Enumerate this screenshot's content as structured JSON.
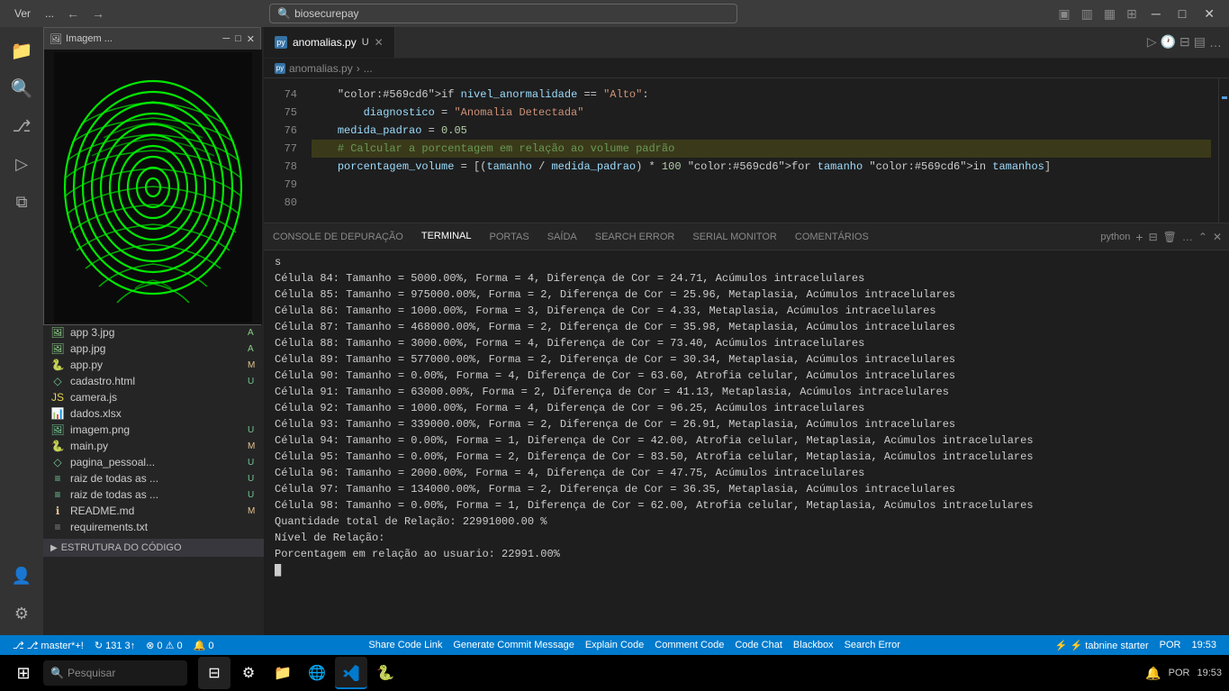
{
  "titleBar": {
    "title": "Imagem ...",
    "controls": [
      "minimize",
      "maximize",
      "close"
    ]
  },
  "menuBar": {
    "items": [
      "Ver"
    ],
    "searchPlaceholder": "biosecurepay",
    "moreBtn": "...",
    "navBack": "←",
    "navForward": "→"
  },
  "tabs": [
    {
      "label": "anomalias.py",
      "modified": true,
      "active": true,
      "icon": "py"
    }
  ],
  "breadcrumb": {
    "parts": [
      "anomalias.py",
      "..."
    ]
  },
  "codeLines": [
    {
      "num": "74",
      "text": "    if nivel_anormalidade == \"Alto\":",
      "highlight": false
    },
    {
      "num": "75",
      "text": "        diagnostico = \"Anomalia Detectada\"",
      "highlight": false
    },
    {
      "num": "76",
      "text": "",
      "highlight": false
    },
    {
      "num": "77",
      "text": "    medida_padrao = 0.05",
      "highlight": false
    },
    {
      "num": "78",
      "text": "",
      "highlight": false
    },
    {
      "num": "79",
      "text": "    # Calcular a porcentagem em relação ao volume padrão",
      "highlight": true
    },
    {
      "num": "80",
      "text": "    porcentagem_volume = [(tamanho / medida_padrao) * 100 for tamanho in tamanhos]",
      "highlight": false
    }
  ],
  "panelTabs": [
    {
      "label": "CONSOLE DE DEPURAÇÃO",
      "active": false
    },
    {
      "label": "TERMINAL",
      "active": true
    },
    {
      "label": "PORTAS",
      "active": false
    },
    {
      "label": "SAÍDA",
      "active": false
    },
    {
      "label": "SEARCH ERROR",
      "active": false
    },
    {
      "label": "SERIAL MONITOR",
      "active": false
    },
    {
      "label": "COMENTÁRIOS",
      "active": false
    }
  ],
  "terminalLanguage": "python",
  "terminalOutput": [
    "s",
    "Célula 84: Tamanho = 5000.00%, Forma = 4, Diferença de Cor = 24.71, Acúmulos intracelulares",
    "Célula 85: Tamanho = 975000.00%, Forma = 2, Diferença de Cor = 25.96, Metaplasia, Acúmulos intracelulares",
    "Célula 86: Tamanho = 1000.00%, Forma = 3, Diferença de Cor = 4.33, Metaplasia, Acúmulos intracelulares",
    "Célula 87: Tamanho = 468000.00%, Forma = 2, Diferença de Cor = 35.98, Metaplasia, Acúmulos intracelulares",
    "Célula 88: Tamanho = 3000.00%, Forma = 4, Diferença de Cor = 73.40, Acúmulos intracelulares",
    "Célula 89: Tamanho = 577000.00%, Forma = 2, Diferença de Cor = 30.34, Metaplasia, Acúmulos intracelulares",
    "Célula 90: Tamanho = 0.00%, Forma = 4, Diferença de Cor = 63.60, Atrofia celular, Acúmulos intracelulares",
    "Célula 91: Tamanho = 63000.00%, Forma = 2, Diferença de Cor = 41.13, Metaplasia, Acúmulos intracelulares",
    "Célula 92: Tamanho = 1000.00%, Forma = 4, Diferença de Cor = 96.25, Acúmulos intracelulares",
    "Célula 93: Tamanho = 339000.00%, Forma = 2, Diferença de Cor = 26.91, Metaplasia, Acúmulos intracelulares",
    "Célula 94: Tamanho = 0.00%, Forma = 1, Diferença de Cor = 42.00, Atrofia celular, Metaplasia, Acúmulos intracelulares",
    "Célula 95: Tamanho = 0.00%, Forma = 2, Diferença de Cor = 83.50, Atrofia celular, Metaplasia, Acúmulos intracelulares",
    "Célula 96: Tamanho = 2000.00%, Forma = 4, Diferença de Cor = 47.75, Acúmulos intracelulares",
    "Célula 97: Tamanho = 134000.00%, Forma = 2, Diferença de Cor = 36.35, Metaplasia, Acúmulos intracelulares",
    "Célula 98: Tamanho = 0.00%, Forma = 1, Diferença de Cor = 62.00, Atrofia celular, Metaplasia, Acúmulos intracelulares",
    "Quantidade total de Relação: 22991000.00 %",
    "Nível de Relação:",
    "Porcentagem em relação ao usuario: 22991.00%",
    "█"
  ],
  "sidebarFiles": [
    {
      "name": "app 3.jpg",
      "icon": "🖼",
      "badge": "A",
      "color": "#89d185"
    },
    {
      "name": "app.jpg",
      "icon": "🖼",
      "badge": "A",
      "color": "#89d185"
    },
    {
      "name": "app.py",
      "icon": "🐍",
      "badge": "M",
      "color": "#e2c08d"
    },
    {
      "name": "cadastro.html",
      "icon": "◇",
      "badge": "U",
      "color": "#73c991"
    },
    {
      "name": "camera.js",
      "icon": "JS",
      "badge": "",
      "color": "#e8d44d"
    },
    {
      "name": "dados.xlsx",
      "icon": "📊",
      "badge": "",
      "color": "#1f6e43"
    },
    {
      "name": "imagem.png",
      "icon": "🖼",
      "badge": "U",
      "color": "#73c991"
    },
    {
      "name": "main.py",
      "icon": "🐍",
      "badge": "M",
      "color": "#e2c08d"
    },
    {
      "name": "pagina_pessoal...",
      "icon": "◇",
      "badge": "U",
      "color": "#73c991"
    },
    {
      "name": "raiz de todas as ...",
      "icon": "≡",
      "badge": "U",
      "color": "#73c991"
    },
    {
      "name": "raiz de todas as ...",
      "icon": "≡",
      "badge": "U",
      "color": "#73c991"
    },
    {
      "name": "README.md",
      "icon": "ℹ",
      "badge": "M",
      "color": "#e2c08d"
    },
    {
      "name": "requirements.txt",
      "icon": "≡",
      "badge": "",
      "color": "#888"
    }
  ],
  "structureSection": "ESTRUTURA DO CÓDIGO",
  "statusBar": {
    "left": [
      {
        "label": "⎇ master*+!",
        "key": "branch"
      },
      {
        "label": "↻ 131 3↑",
        "key": "sync"
      },
      {
        "label": "⊗ 0  ⚠ 0",
        "key": "errors"
      },
      {
        "label": "🔔 0",
        "key": "notifs"
      }
    ],
    "middle": [
      {
        "label": "Share Code Link",
        "key": "share"
      },
      {
        "label": "Generate Commit Message",
        "key": "commit"
      },
      {
        "label": "Explain Code",
        "key": "explain"
      },
      {
        "label": "Comment Code",
        "key": "comment"
      },
      {
        "label": "Code Chat",
        "key": "codechat"
      },
      {
        "label": "Blackbox",
        "key": "blackbox"
      },
      {
        "label": "Search Error",
        "key": "searcherror"
      }
    ],
    "right": [
      {
        "label": "⚡ tabnine starter",
        "key": "tabnine"
      },
      {
        "label": "POR",
        "key": "lang"
      },
      {
        "label": "19:53",
        "key": "time"
      }
    ]
  },
  "windowsTaskbar": {
    "startLabel": "⊞",
    "searchPlaceholder": "Pesquisar",
    "time": "19:53",
    "lang": "POR"
  },
  "imageWindow": {
    "title": "Imagem ..."
  }
}
